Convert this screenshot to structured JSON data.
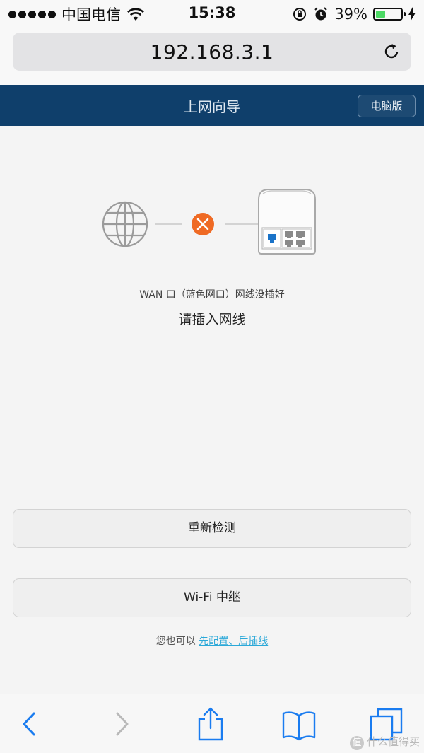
{
  "status_bar": {
    "carrier": "中国电信",
    "time": "15:38",
    "battery_percent": "39%",
    "battery_level": 0.39,
    "battery_color": "#4cd964"
  },
  "browser": {
    "url": "192.168.3.1",
    "reload_icon": "reload-icon"
  },
  "header": {
    "title": "上网向导",
    "desktop_button": "电脑版",
    "background": "#0f3f6b"
  },
  "diagram": {
    "error_color": "#ef6a24",
    "wan_port_color": "#1a73c8"
  },
  "status": {
    "detail": "WAN 口（蓝色网口）网线没插好",
    "message": "请插入网线"
  },
  "actions": {
    "retry": "重新检测",
    "wifi_relay": "Wi-Fi 中继"
  },
  "hint": {
    "prefix": "您也可以 ",
    "link": "先配置、后插线"
  },
  "toolbar": {
    "icons": [
      "back-icon",
      "forward-icon",
      "share-icon",
      "bookmarks-icon",
      "tabs-icon"
    ],
    "accent": "#1a7cf0"
  },
  "watermark": {
    "badge": "值",
    "text": "什么值得买"
  }
}
